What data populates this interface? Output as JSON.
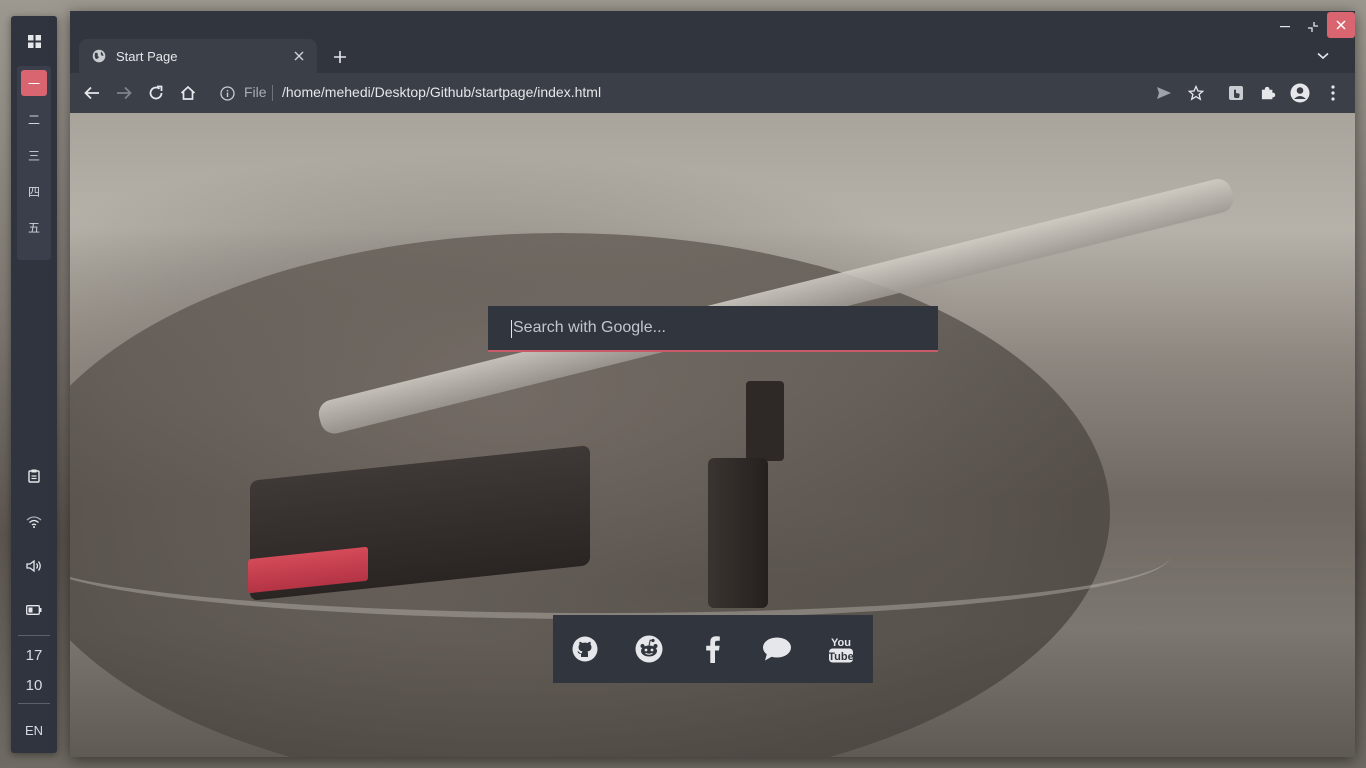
{
  "dock": {
    "workspaces": [
      {
        "label": "一",
        "active": true
      },
      {
        "label": "二",
        "active": false
      },
      {
        "label": "三",
        "active": false
      },
      {
        "label": "四",
        "active": false
      },
      {
        "label": "五",
        "active": false
      }
    ],
    "clock_hour": "17",
    "clock_minute": "10",
    "language": "EN"
  },
  "browser": {
    "tab_title": "Start Page",
    "omnibox_scheme": "File",
    "omnibox_url": "/home/mehedi/Desktop/Github/startpage/index.html"
  },
  "page": {
    "search_placeholder": "Search with Google...",
    "accent_color": "#d8656f",
    "links": [
      "github-icon",
      "reddit-icon",
      "facebook-icon",
      "chat-icon",
      "youtube-icon"
    ]
  }
}
